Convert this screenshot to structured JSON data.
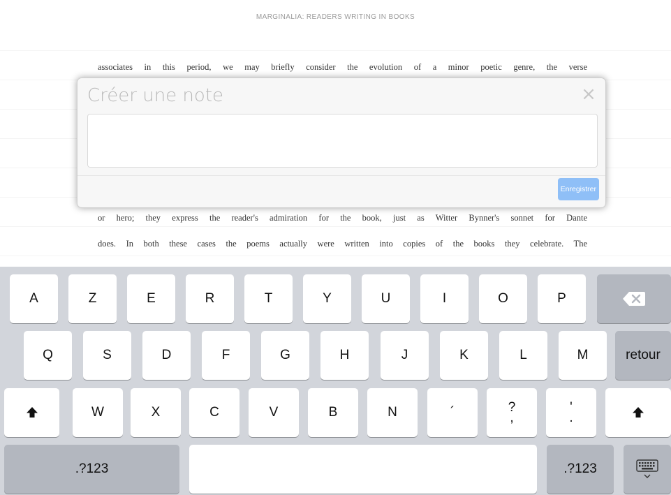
{
  "header": {
    "title": "MARGINALIA: READERS WRITING IN BOOKS"
  },
  "book": {
    "line1": "associates in this period, we may briefly consider the evolution of a minor poetic genre, the verse",
    "line2": "or hero; they express the reader's admiration for the book, just as Witter Bynner's sonnet for Dante",
    "line3": "does. In both these cases the poems actually were written into copies of the books they celebrate. The"
  },
  "note_dialog": {
    "title": "Créer une note",
    "close_glyph": "×",
    "text_value": "",
    "save_label": "Enregistrer",
    "save_color": "#8fbff7"
  },
  "keyboard": {
    "row1": [
      "A",
      "Z",
      "E",
      "R",
      "T",
      "Y",
      "U",
      "I",
      "O",
      "P"
    ],
    "row2": [
      "Q",
      "S",
      "D",
      "F",
      "G",
      "H",
      "J",
      "K",
      "L",
      "M"
    ],
    "row3": [
      "W",
      "X",
      "C",
      "V",
      "B",
      "N"
    ],
    "accent_key": "´",
    "question_key": {
      "top": "?",
      "bottom": ","
    },
    "apostrophe_key": {
      "top": "'",
      "bottom": "."
    },
    "return_label": "retour",
    "numbers_label": ".?123",
    "backspace_icon": "backspace-icon",
    "shift_icon": "shift-icon",
    "hide_keyboard_icon": "hide-keyboard-icon"
  }
}
